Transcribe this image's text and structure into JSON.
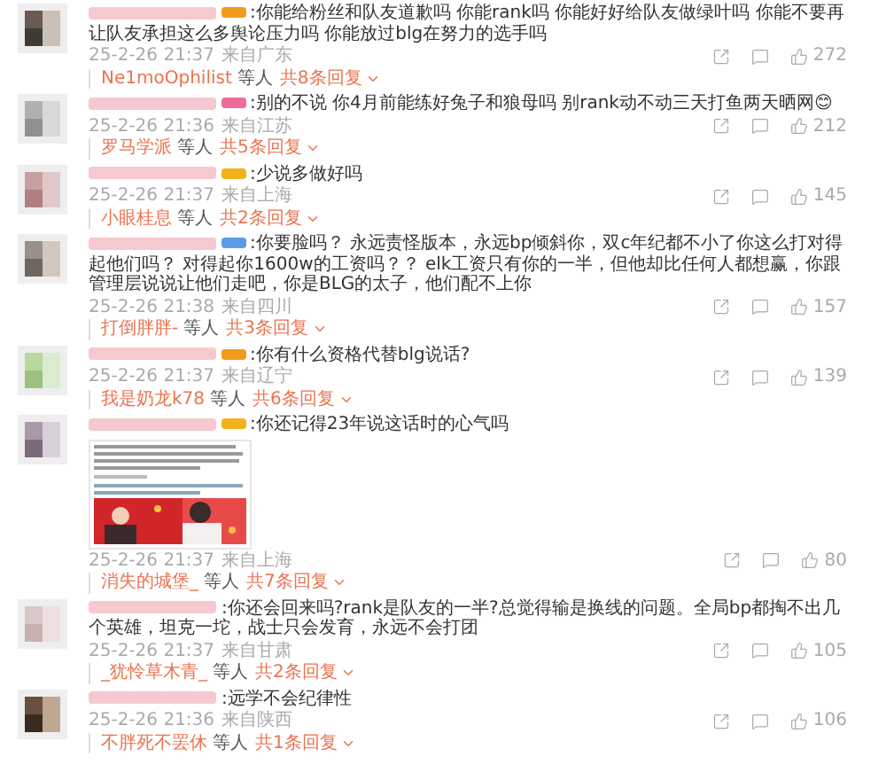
{
  "comments": [
    {
      "badge": {
        "color": "#f29a1e"
      },
      "text": ":你能给粉丝和队友道歉吗 你能rank吗 你能好好给队友做绿叶吗 你能不要再让队友承担这么多舆论压力吗 你能放过blg在努力的选手吗",
      "time": "25-2-26 21:37",
      "location": "来自广东",
      "likes": "272",
      "reply": {
        "user": "Ne1moOphilist",
        "others": "等人",
        "count": "共8条回复"
      }
    },
    {
      "badge": {
        "color": "#f06a9a"
      },
      "text": ":别的不说 你4月前能练好兔子和狼母吗 别rank动不动三天打鱼两天晒网😊",
      "time": "25-2-26 21:36",
      "location": "来自江苏",
      "likes": "212",
      "reply": {
        "user": "罗马学派",
        "others": "等人",
        "count": "共5条回复"
      }
    },
    {
      "badge": {
        "color": "#f2b21e"
      },
      "text": ":少说多做好吗",
      "time": "25-2-26 21:37",
      "location": "来自上海",
      "likes": "145",
      "reply": {
        "user": "小眼桂息",
        "others": "等人",
        "count": "共2条回复"
      }
    },
    {
      "badge": {
        "color": "#5b9be6"
      },
      "text": ":你要脸吗？ 永远责怪版本，永远bp倾斜你，双c年纪都不小了你这么打对得起他们吗？ 对得起你1600w的工资吗？？ elk工资只有你的一半，但他却比任何人都想赢，你跟管理层说说让他们走吧，你是BLG的太子，他们配不上你",
      "time": "25-2-26 21:38",
      "location": "来自四川",
      "likes": "157",
      "reply": {
        "user": "打倒胖胖-",
        "others": "等人",
        "count": "共3条回复"
      }
    },
    {
      "badge": {
        "color": "#f29a1e"
      },
      "text": ":你有什么资格代替blg说话?",
      "time": "25-2-26 21:37",
      "location": "来自辽宁",
      "likes": "139",
      "reply": {
        "user": "我是奶龙k78",
        "others": "等人",
        "count": "共6条回复"
      }
    },
    {
      "badge": {
        "color": "#f2b21e"
      },
      "text": ":你还记得23年说这话时的心气吗",
      "time": "25-2-26 21:37",
      "location": "来自上海",
      "likes": "80",
      "reply": {
        "user": "消失的城堡_",
        "others": "等人",
        "count": "共7条回复"
      }
    },
    {
      "text": ":你还会回来吗?rank是队友的一半?总觉得输是换线的问题。全局bp都掏不出几个英雄，坦克一坨，战士只会发育，永远不会打团",
      "time": "25-2-26 21:37",
      "location": "来自甘肃",
      "likes": "105",
      "reply": {
        "user": "_犹怜草木青_",
        "others": "等人",
        "count": "共2条回复"
      }
    },
    {
      "text": ":远学不会纪律性",
      "time": "25-2-26 21:36",
      "location": "来自陕西",
      "likes": "106",
      "reply": {
        "user": "不胖死不罢休",
        "others": "等人",
        "count": "共1条回复"
      }
    }
  ]
}
